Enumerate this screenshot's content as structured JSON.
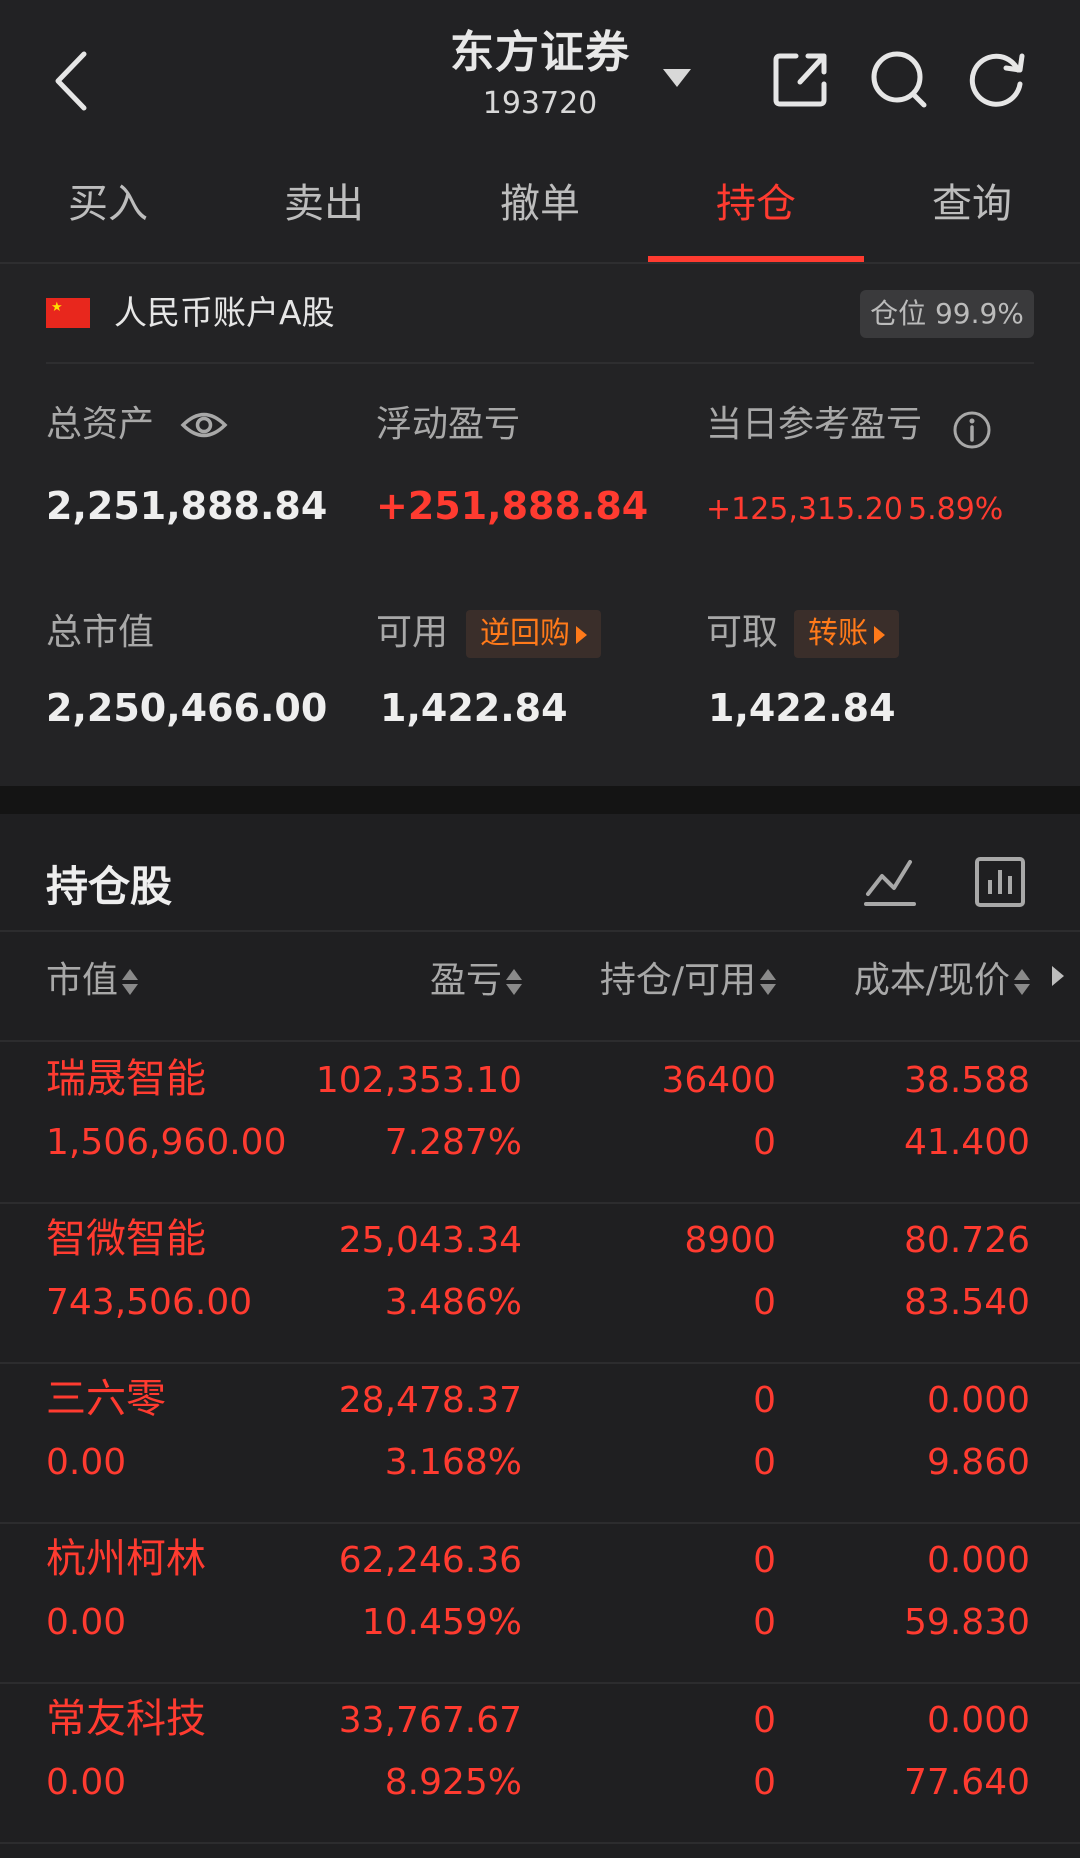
{
  "header": {
    "title": "东方证券",
    "code": "193720"
  },
  "tabs": [
    "买入",
    "卖出",
    "撤单",
    "持仓",
    "查询"
  ],
  "active_tab": "持仓",
  "account": {
    "name": "人民币账户A股",
    "position_badge": "仓位 99.9%",
    "total_assets_label": "总资产",
    "total_assets": "2,251,888.84",
    "floating_pl_label": "浮动盈亏",
    "floating_pl": "+251,888.84",
    "daily_pl_label": "当日参考盈亏",
    "daily_pl": "+125,315.20",
    "daily_pl_pct": "5.89%",
    "market_value_label": "总市值",
    "market_value": "2,250,466.00",
    "available_label": "可用",
    "available_badge": "逆回购",
    "available": "1,422.84",
    "withdrawable_label": "可取",
    "withdrawable_badge": "转账",
    "withdrawable": "1,422.84"
  },
  "holdings": {
    "title": "持仓股",
    "columns": [
      "市值",
      "盈亏",
      "持仓/可用",
      "成本/现价"
    ],
    "rows": [
      {
        "name": "瑞晟智能",
        "market_value": "1,506,960.00",
        "pl": "102,353.10",
        "pl_pct": "7.287%",
        "position": "36400",
        "available": "0",
        "cost": "38.588",
        "price": "41.400"
      },
      {
        "name": "智微智能",
        "market_value": "743,506.00",
        "pl": "25,043.34",
        "pl_pct": "3.486%",
        "position": "8900",
        "available": "0",
        "cost": "80.726",
        "price": "83.540"
      },
      {
        "name": "三六零",
        "market_value": "0.00",
        "pl": "28,478.37",
        "pl_pct": "3.168%",
        "position": "0",
        "available": "0",
        "cost": "0.000",
        "price": "9.860"
      },
      {
        "name": "杭州柯林",
        "market_value": "0.00",
        "pl": "62,246.36",
        "pl_pct": "10.459%",
        "position": "0",
        "available": "0",
        "cost": "0.000",
        "price": "59.830"
      },
      {
        "name": "常友科技",
        "market_value": "0.00",
        "pl": "33,767.67",
        "pl_pct": "8.925%",
        "position": "0",
        "available": "0",
        "cost": "0.000",
        "price": "77.640"
      }
    ]
  },
  "colors": {
    "accent_red": "#ff3b30",
    "badge_orange": "#ff7a1a",
    "background": "#1c1c1e"
  },
  "icons": [
    "back-arrow-icon",
    "dropdown-caret-icon",
    "share-icon",
    "search-icon",
    "refresh-icon",
    "eye-icon",
    "info-icon",
    "trend-line-icon",
    "bar-chart-icon"
  ]
}
